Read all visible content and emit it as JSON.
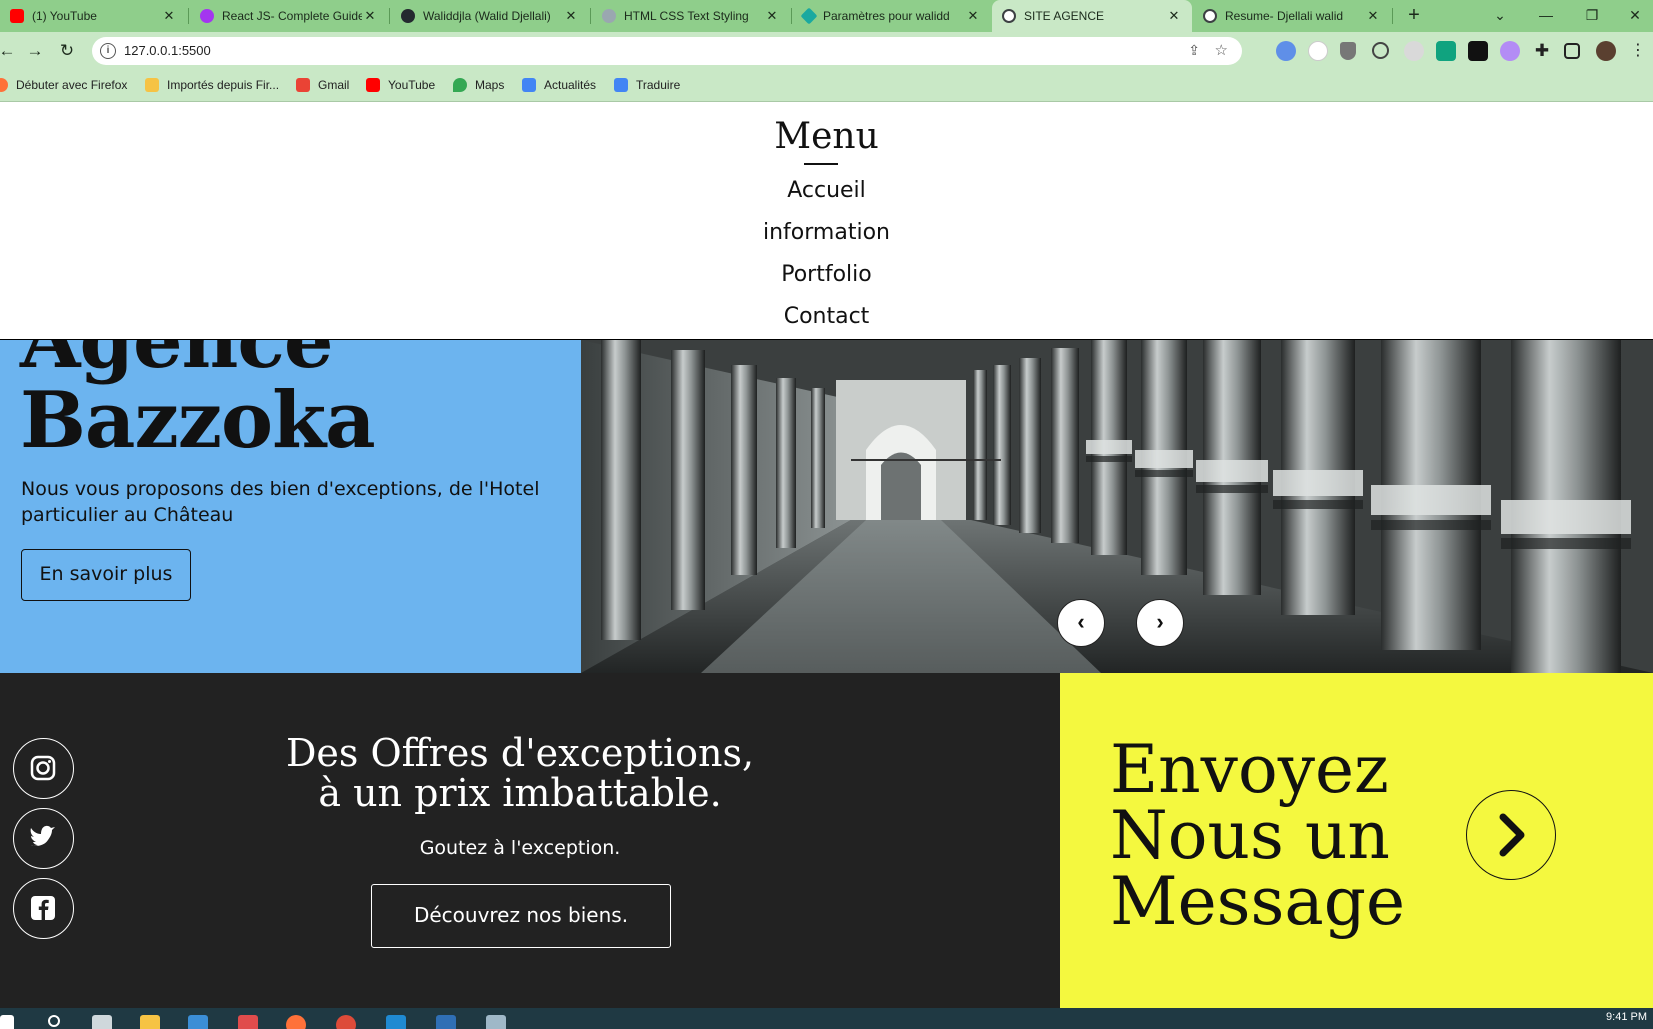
{
  "browser": {
    "tabs": [
      {
        "title": "(1) YouTube",
        "favicon_color": "#ff0000"
      },
      {
        "title": "React JS- Complete Guide",
        "favicon_color": "#a435f0"
      },
      {
        "title": "Waliddjla (Walid Djellali)",
        "favicon_color": "#24292f"
      },
      {
        "title": "HTML CSS Text Styling",
        "favicon_color": "#9aa7b0"
      },
      {
        "title": "Paramètres pour walidd",
        "favicon_color": "#1aa9a0"
      },
      {
        "title": "SITE AGENCE",
        "favicon_color": "#3c4043"
      },
      {
        "title": "Resume- Djellali walid",
        "favicon_color": "#3c4043"
      }
    ],
    "active_tab_index": 5,
    "url": "127.0.0.1:5500",
    "bookmarks": [
      {
        "label": "Débuter avec Firefox",
        "color": "#ff7139"
      },
      {
        "label": "Importés depuis Fir...",
        "color": "#f6c344"
      },
      {
        "label": "Gmail",
        "color": "#ea4335"
      },
      {
        "label": "YouTube",
        "color": "#ff0000"
      },
      {
        "label": "Maps",
        "color": "#34a853"
      },
      {
        "label": "Actualités",
        "color": "#4285f4"
      },
      {
        "label": "Traduire",
        "color": "#4285f4"
      }
    ]
  },
  "menu": {
    "title": "Menu",
    "items": [
      "Accueil",
      "information",
      "Portfolio",
      "Contact"
    ]
  },
  "hero": {
    "title_line1": "Agence",
    "title_line2": "Bazzoka",
    "subtitle": "Nous vous proposons des bien d'exceptions, de l'Hotel particulier au Château",
    "button": "En savoir plus",
    "bg_color": "#6cb4ef"
  },
  "promo": {
    "title_line1": "Des Offres d'exceptions,",
    "title_line2": "à un prix imbattable.",
    "subtitle": "Goutez à l'exception.",
    "button": "Découvrez nos biens.",
    "social": [
      "instagram-icon",
      "twitter-icon",
      "facebook-icon"
    ]
  },
  "contact": {
    "title_line1": "Envoyez",
    "title_line2": "Nous un",
    "title_line3": "Message",
    "bg_color": "#f4f83f"
  },
  "taskbar": {
    "clock": "9:41 PM"
  }
}
